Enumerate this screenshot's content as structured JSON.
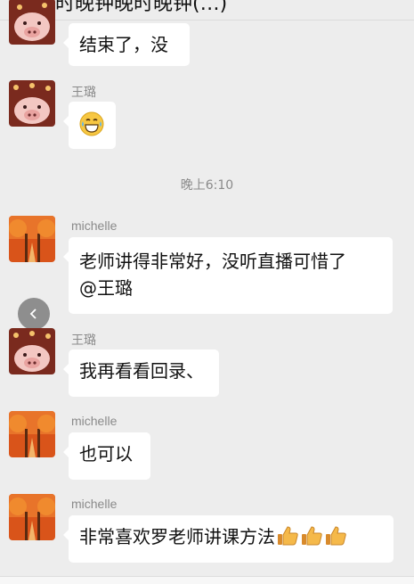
{
  "header": {
    "back_glyph": "〈",
    "title": "一时晚钟晚时晚钟(…)"
  },
  "timestamp": "晚上6:10",
  "messages": [
    {
      "sender": "",
      "text": "结束了，没",
      "avatar": "pig-avatar"
    },
    {
      "sender": "王璐",
      "emoji": "grinning-sweat-emoji",
      "avatar": "pig-avatar"
    },
    {
      "sender": "michelle",
      "lines": [
        "老师讲得非常好，没听直播可惜了",
        "@王璐"
      ],
      "avatar": "autumn-avatar"
    },
    {
      "sender": "王璐",
      "text": "我再看看回录、",
      "avatar": "pig-avatar"
    },
    {
      "sender": "michelle",
      "text": "也可以",
      "avatar": "autumn-avatar"
    },
    {
      "sender": "michelle",
      "text": "非常喜欢罗老师讲课方法",
      "emoji": "thumbs-up-icon ×3",
      "avatar": "autumn-avatar"
    }
  ],
  "colors": {
    "background": "#ededed",
    "bubble": "#ffffff",
    "meta_text": "#8a8a8a"
  }
}
